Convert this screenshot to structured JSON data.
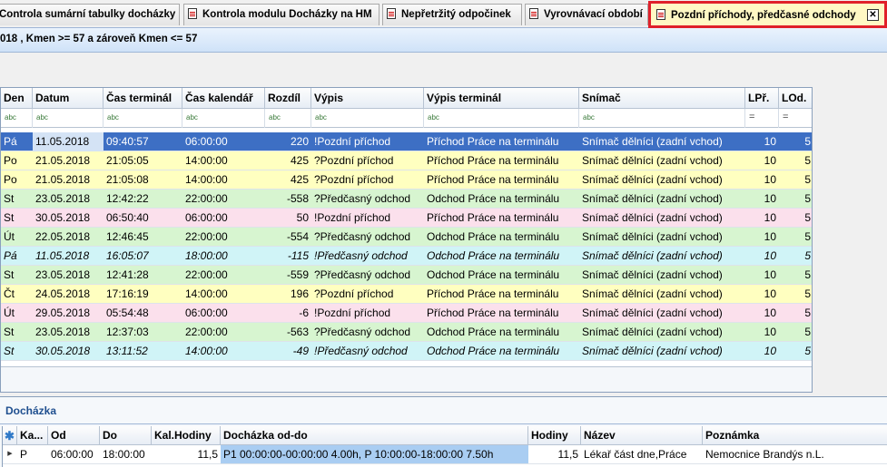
{
  "tabs": [
    {
      "label": "Controla sumární tabulky docházky",
      "active": false
    },
    {
      "label": "Kontrola modulu Docházky na HM",
      "active": false
    },
    {
      "label": "Nepřetržitý odpočinek",
      "active": false
    },
    {
      "label": "Vyrovnávací období",
      "active": false
    },
    {
      "label": "Pozdní příchody, předčasné odchody",
      "active": true
    }
  ],
  "filter_text": "018 , Kmen >= 57  a zároveň  Kmen <= 57",
  "columns": [
    "Den",
    "Datum",
    "Čas terminál",
    "Čas kalendář",
    "Rozdíl",
    "Výpis",
    "Výpis terminál",
    "Snímač",
    "LPř.",
    "LOd."
  ],
  "filter_row": [
    "abc",
    "abc",
    "abc",
    "abc",
    "abc",
    "abc",
    "abc",
    "abc",
    "=",
    "="
  ],
  "rows": [
    {
      "den": "Pá",
      "datum": "11.05.2018",
      "cas_terminal": "09:40:57",
      "cas_kalendar": "06:00:00",
      "rozdil": "220",
      "vypis": "!Pozdní příchod",
      "vypis_terminal": "Příchod Práce na terminálu",
      "snimac": "Snímač dělníci (zadní vchod)",
      "lpr": "10",
      "lod": "5",
      "color": "#3d6fc4",
      "italic": false,
      "selected": true
    },
    {
      "den": "Po",
      "datum": "21.05.2018",
      "cas_terminal": "21:05:05",
      "cas_kalendar": "14:00:00",
      "rozdil": "425",
      "vypis": "?Pozdní příchod",
      "vypis_terminal": "Příchod Práce na terminálu",
      "snimac": "Snímač dělníci (zadní vchod)",
      "lpr": "10",
      "lod": "5",
      "color": "#ffffc0",
      "italic": false,
      "selected": false
    },
    {
      "den": "Po",
      "datum": "21.05.2018",
      "cas_terminal": "21:05:08",
      "cas_kalendar": "14:00:00",
      "rozdil": "425",
      "vypis": "?Pozdní příchod",
      "vypis_terminal": "Příchod Práce na terminálu",
      "snimac": "Snímač dělníci (zadní vchod)",
      "lpr": "10",
      "lod": "5",
      "color": "#ffffc0",
      "italic": false,
      "selected": false
    },
    {
      "den": "St",
      "datum": "23.05.2018",
      "cas_terminal": "12:42:22",
      "cas_kalendar": "22:00:00",
      "rozdil": "-558",
      "vypis": "?Předčasný odchod",
      "vypis_terminal": "Odchod Práce na terminálu",
      "snimac": "Snímač dělníci (zadní vchod)",
      "lpr": "10",
      "lod": "5",
      "color": "#d7f5d0",
      "italic": false,
      "selected": false
    },
    {
      "den": "St",
      "datum": "30.05.2018",
      "cas_terminal": "06:50:40",
      "cas_kalendar": "06:00:00",
      "rozdil": "50",
      "vypis": "!Pozdní příchod",
      "vypis_terminal": "Příchod Práce na terminálu",
      "snimac": "Snímač dělníci (zadní vchod)",
      "lpr": "10",
      "lod": "5",
      "color": "#fbe0ec",
      "italic": false,
      "selected": false
    },
    {
      "den": "Út",
      "datum": "22.05.2018",
      "cas_terminal": "12:46:45",
      "cas_kalendar": "22:00:00",
      "rozdil": "-554",
      "vypis": "?Předčasný odchod",
      "vypis_terminal": "Odchod Práce na terminálu",
      "snimac": "Snímač dělníci (zadní vchod)",
      "lpr": "10",
      "lod": "5",
      "color": "#d7f5d0",
      "italic": false,
      "selected": false
    },
    {
      "den": "Pá",
      "datum": "11.05.2018",
      "cas_terminal": "16:05:07",
      "cas_kalendar": "18:00:00",
      "rozdil": "-115",
      "vypis": "!Předčasný odchod",
      "vypis_terminal": "Odchod Práce na terminálu",
      "snimac": "Snímač dělníci (zadní vchod)",
      "lpr": "10",
      "lod": "5",
      "color": "#d0f4f7",
      "italic": true,
      "selected": false
    },
    {
      "den": "St",
      "datum": "23.05.2018",
      "cas_terminal": "12:41:28",
      "cas_kalendar": "22:00:00",
      "rozdil": "-559",
      "vypis": "?Předčasný odchod",
      "vypis_terminal": "Odchod Práce na terminálu",
      "snimac": "Snímač dělníci (zadní vchod)",
      "lpr": "10",
      "lod": "5",
      "color": "#d7f5d0",
      "italic": false,
      "selected": false
    },
    {
      "den": "Čt",
      "datum": "24.05.2018",
      "cas_terminal": "17:16:19",
      "cas_kalendar": "14:00:00",
      "rozdil": "196",
      "vypis": "?Pozdní příchod",
      "vypis_terminal": "Příchod Práce na terminálu",
      "snimac": "Snímač dělníci (zadní vchod)",
      "lpr": "10",
      "lod": "5",
      "color": "#ffffc0",
      "italic": false,
      "selected": false
    },
    {
      "den": "Út",
      "datum": "29.05.2018",
      "cas_terminal": "05:54:48",
      "cas_kalendar": "06:00:00",
      "rozdil": "-6",
      "vypis": "!Pozdní příchod",
      "vypis_terminal": "Příchod Práce na terminálu",
      "snimac": "Snímač dělníci (zadní vchod)",
      "lpr": "10",
      "lod": "5",
      "color": "#fbe0ec",
      "italic": false,
      "selected": false
    },
    {
      "den": "St",
      "datum": "23.05.2018",
      "cas_terminal": "12:37:03",
      "cas_kalendar": "22:00:00",
      "rozdil": "-563",
      "vypis": "?Předčasný odchod",
      "vypis_terminal": "Odchod Práce na terminálu",
      "snimac": "Snímač dělníci (zadní vchod)",
      "lpr": "10",
      "lod": "5",
      "color": "#d7f5d0",
      "italic": false,
      "selected": false
    },
    {
      "den": "St",
      "datum": "30.05.2018",
      "cas_terminal": "13:11:52",
      "cas_kalendar": "14:00:00",
      "rozdil": "-49",
      "vypis": "!Předčasný odchod",
      "vypis_terminal": "Odchod Práce na terminálu",
      "snimac": "Snímač dělníci (zadní vchod)",
      "lpr": "10",
      "lod": "5",
      "color": "#d0f4f7",
      "italic": true,
      "selected": false
    }
  ],
  "panel": {
    "title": "Docházka",
    "columns": [
      "Ka...",
      "Od",
      "Do",
      "Kal.Hodiny",
      "Docházka od-do",
      "Hodiny",
      "Název",
      "Poznámka"
    ],
    "row": {
      "ka": "P",
      "od": "06:00:00",
      "do": "18:00:00",
      "kal_hodiny": "11,5",
      "dochazka": "P1 00:00:00-00:00:00 4.00h, P 10:00:00-18:00:00 7.50h",
      "hodiny": "11,5",
      "nazev": "Lékař část dne,Práce",
      "poznamka": "Nemocnice Brandýs n.L."
    }
  }
}
